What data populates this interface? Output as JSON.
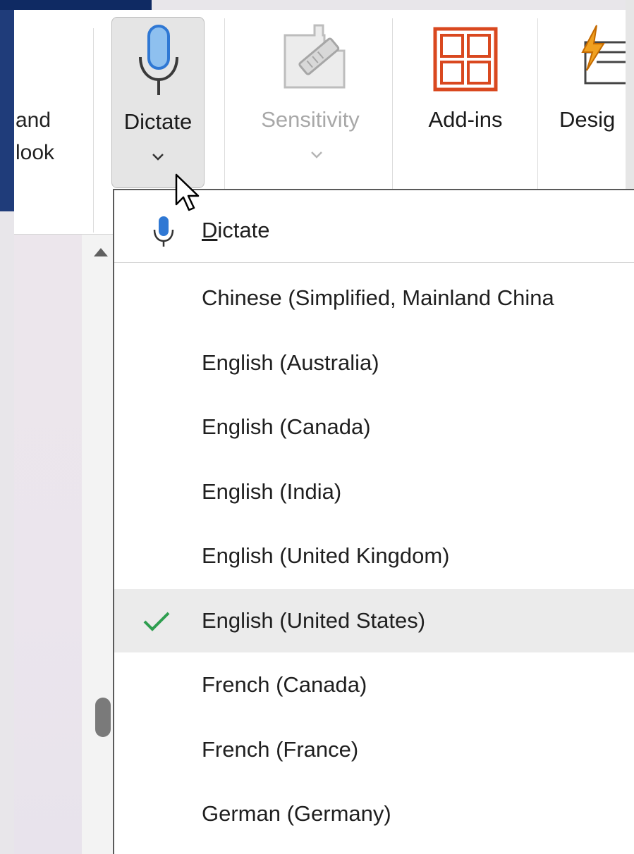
{
  "ribbon": {
    "partial_group_label_line1": "and",
    "partial_group_label_line2": "look",
    "dictate_label": "Dictate",
    "sensitivity_label": "Sensitivity",
    "addins_label": "Add-ins",
    "design_label": "Desig"
  },
  "menu": {
    "dictate_item": {
      "accel": "D",
      "rest": "ictate"
    },
    "languages": [
      {
        "label": "Chinese (Simplified, Mainland China",
        "selected": false
      },
      {
        "label": "English (Australia)",
        "selected": false
      },
      {
        "label": "English (Canada)",
        "selected": false
      },
      {
        "label": "English (India)",
        "selected": false
      },
      {
        "label": "English (United Kingdom)",
        "selected": false
      },
      {
        "label": "English (United States)",
        "selected": true
      },
      {
        "label": "French (Canada)",
        "selected": false
      },
      {
        "label": "French (France)",
        "selected": false
      },
      {
        "label": "German (Germany)",
        "selected": false
      }
    ]
  },
  "icons": {
    "dictate": "microphone-icon",
    "sensitivity": "sensitivity-label-icon",
    "addins": "addins-grid-icon",
    "design": "designer-icon",
    "selected_mark": "checkmark-icon",
    "cursor": "mouse-pointer-icon"
  },
  "colors": {
    "mic_blue": "#2f78d4",
    "addins_orange": "#d9481f",
    "check_green": "#2e9e4f",
    "design_orange": "#f0a020"
  }
}
